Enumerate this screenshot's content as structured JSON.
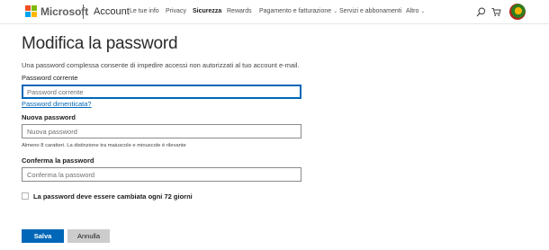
{
  "header": {
    "brand": "Microsoft",
    "section": "Account",
    "nav": [
      {
        "label": "Le tue info",
        "active": false
      },
      {
        "label": "Privacy",
        "active": false
      },
      {
        "label": "Sicurezza",
        "active": true
      },
      {
        "label": "Rewards",
        "active": false
      },
      {
        "label": "Pagamento e fatturazione",
        "active": false,
        "dropdown": true
      },
      {
        "label": "Servizi e abbonamenti",
        "active": false
      },
      {
        "label": "Altro",
        "active": false,
        "dropdown": true
      }
    ],
    "icons": [
      "search-icon",
      "cart-icon",
      "avatar"
    ]
  },
  "main": {
    "title": "Modifica la password",
    "description": "Una password complessa consente di impedire accessi non autorizzati al tuo account e-mail.",
    "current": {
      "label": "Password corrente",
      "placeholder": "Password corrente",
      "value": ""
    },
    "forgot_link": "Password dimenticata?",
    "new": {
      "label": "Nuova password",
      "placeholder": "Nuova password",
      "value": ""
    },
    "hint": "Almeno 8 caratteri. La distinzione tra maiuscole e minuscole è rilevante",
    "confirm": {
      "label": "Conferma la password",
      "placeholder": "Conferma la password",
      "value": ""
    },
    "expire_checkbox": {
      "label": "La password deve essere cambiata ogni 72 giorni",
      "checked": false
    }
  },
  "buttons": {
    "save": "Salva",
    "cancel": "Annulla"
  },
  "colors": {
    "accent": "#0067b8",
    "secondary_button": "#cccccc"
  }
}
